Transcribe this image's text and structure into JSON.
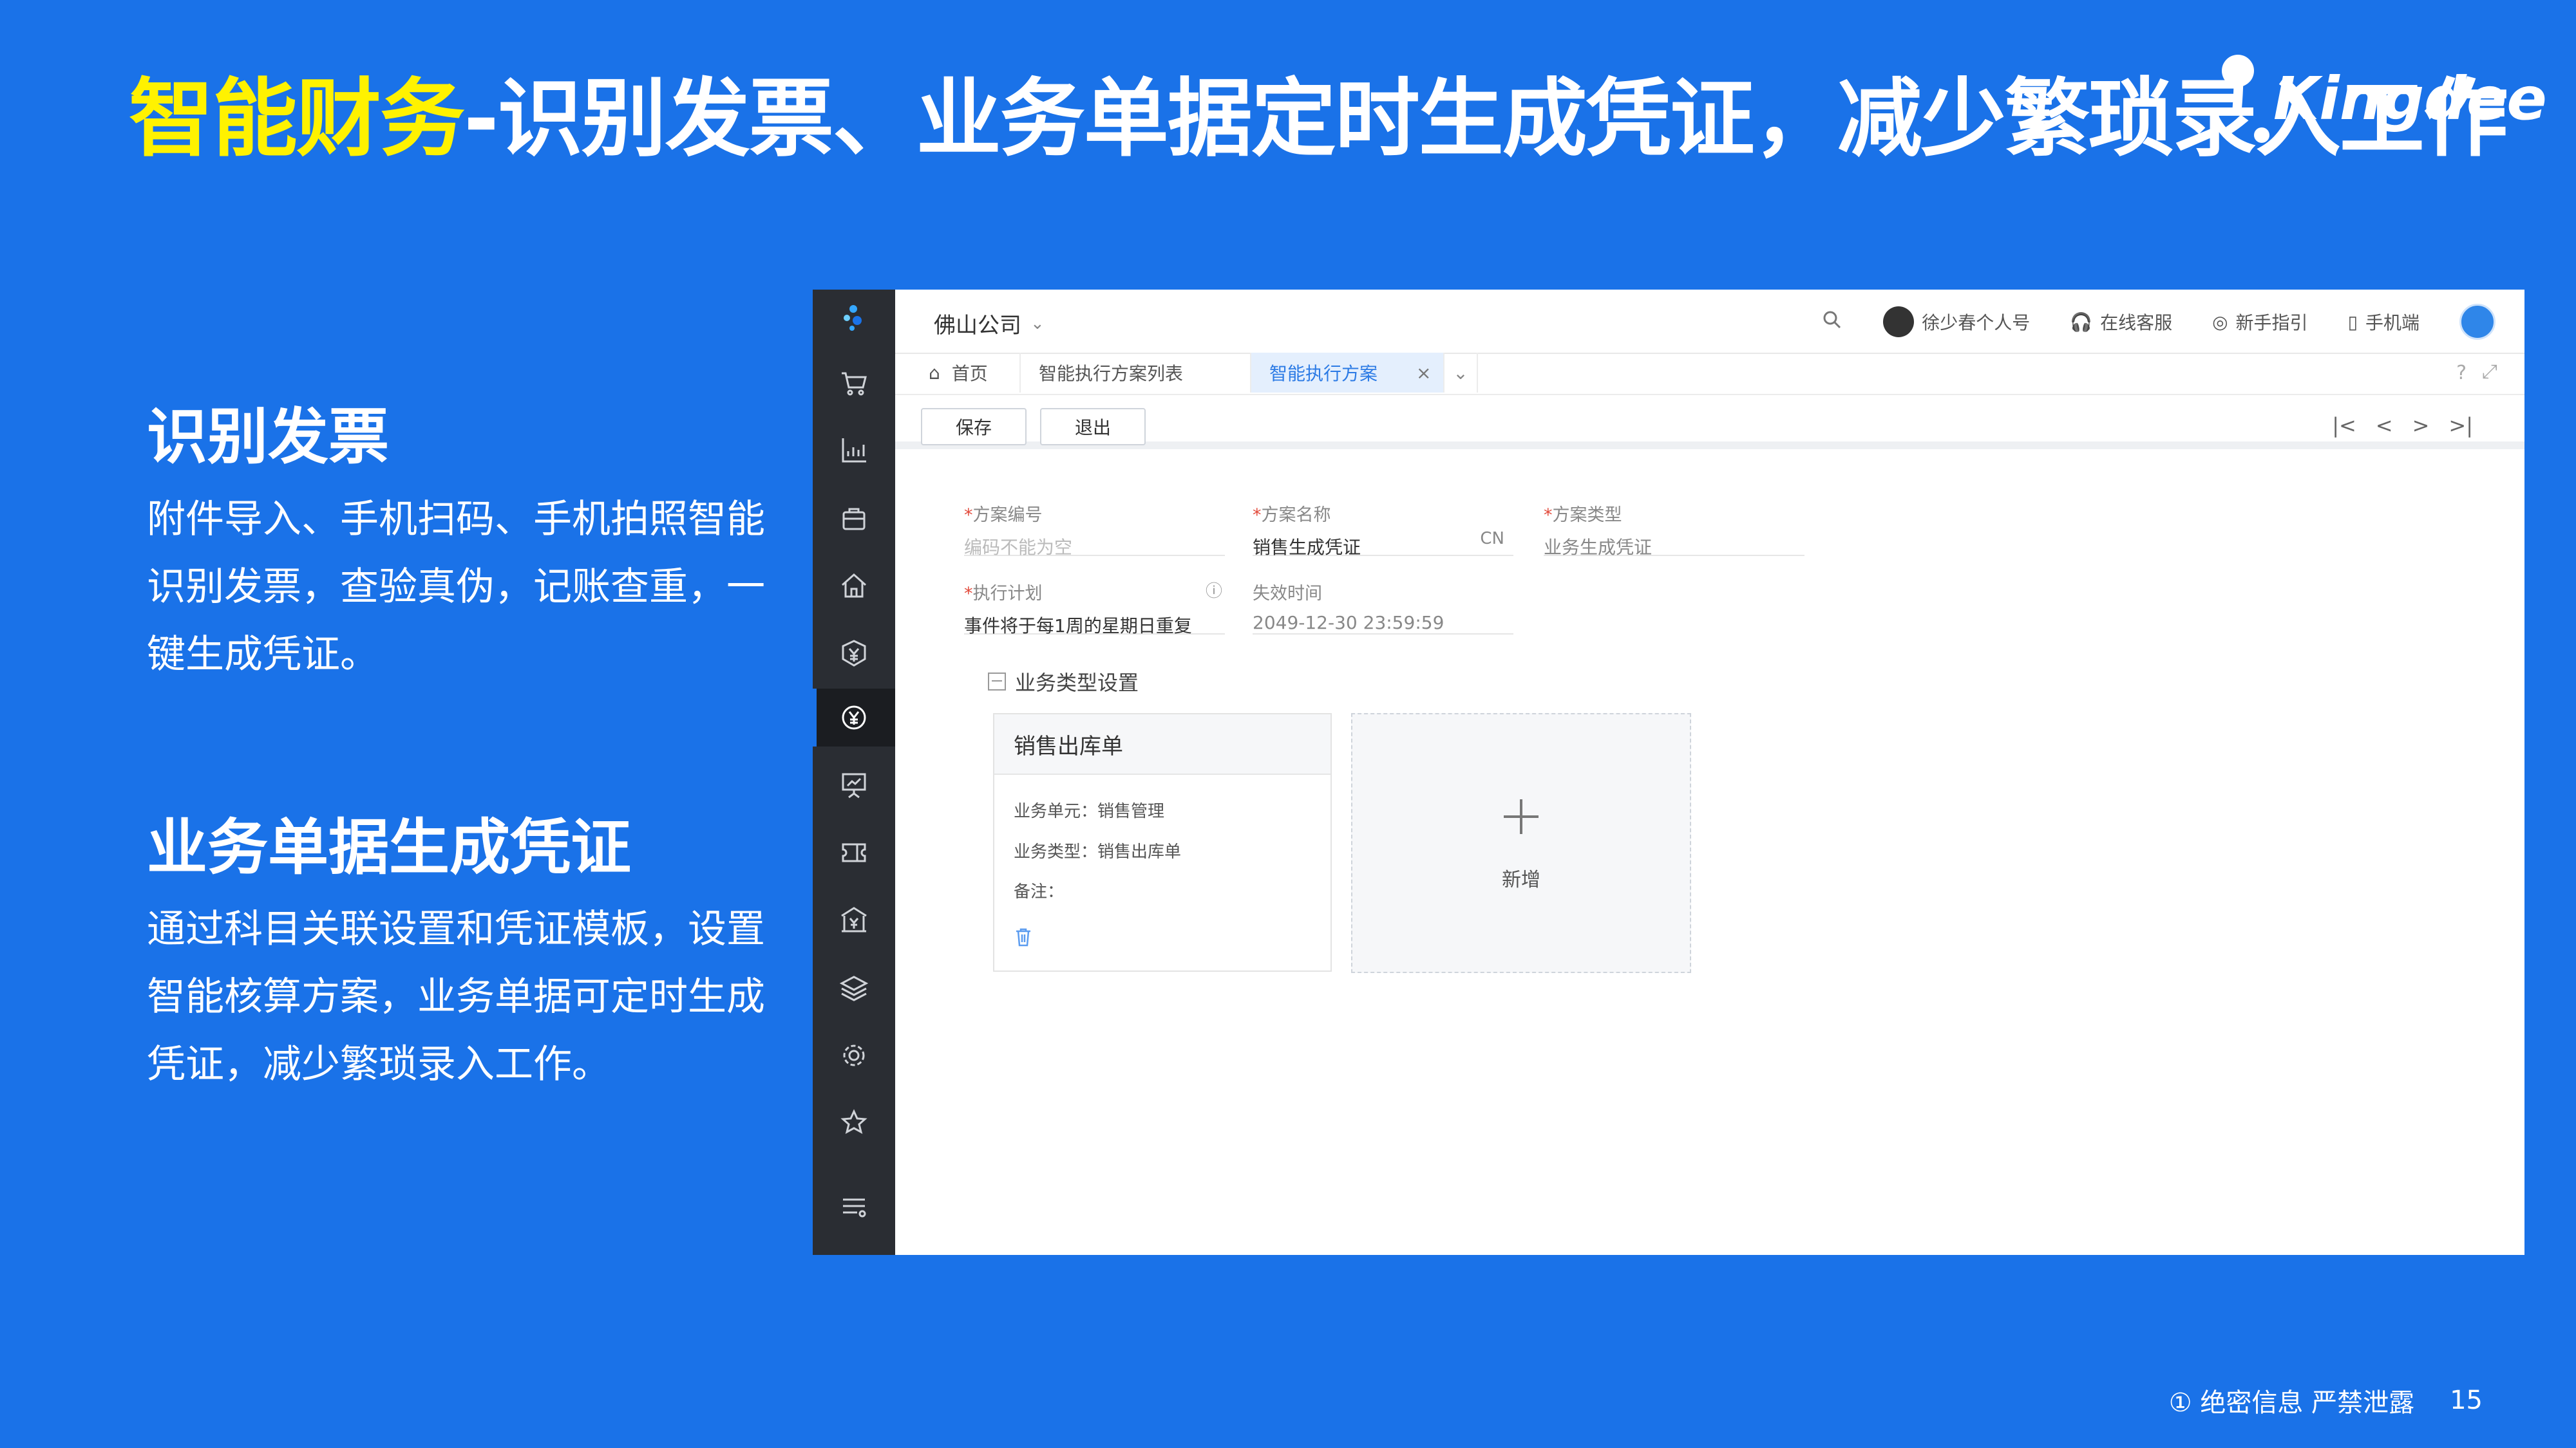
{
  "slide": {
    "title_highlight": "智能财务",
    "title_rest": "-识别发票、业务单据定时生成凭证，减少繁琐录入工作",
    "logo_text": "Kingdee",
    "section1": {
      "title": "识别发票",
      "body": "附件导入、手机扫码、手机拍照智能识别发票，查验真伪，记账查重，一键生成凭证。"
    },
    "section2": {
      "title": "业务单据生成凭证",
      "body": "通过科目关联设置和凭证模板，设置智能核算方案，业务单据可定时生成凭证，减少繁琐录入工作。"
    },
    "footer": {
      "confidential": "① 绝密信息 严禁泄露",
      "page": "15"
    }
  },
  "app": {
    "company": "佛山公司",
    "topbar": {
      "user": "徐少春个人号",
      "service": "在线客服",
      "guide": "新手指引",
      "mobile": "手机端"
    },
    "tabs": [
      "首页",
      "智能执行方案列表",
      "智能执行方案"
    ],
    "toolbar": {
      "save": "保存",
      "exit": "退出"
    },
    "form": {
      "code_label": "方案编号",
      "code_placeholder": "编码不能为空",
      "name_label": "方案名称",
      "name_value": "销售生成凭证",
      "name_lang": "CN",
      "type_label": "方案类型",
      "type_value": "业务生成凭证",
      "plan_label": "执行计划",
      "plan_value": "事件将于每1周的星期日重复",
      "expire_label": "失效时间",
      "expire_value": "2049-12-30 23:59:59"
    },
    "group_title": "业务类型设置",
    "card": {
      "title": "销售出库单",
      "unit": "业务单元：销售管理",
      "type": "业务类型：销售出库单",
      "remark": "备注："
    },
    "add_label": "新增",
    "colors": {
      "accent": "#2c7be5",
      "sidebar": "#2a2d33",
      "slide_bg": "#1a72e8",
      "title_highlight": "#fff200"
    },
    "sidebar_icons": [
      "logo-icon",
      "cart-icon",
      "chart-icon",
      "bag-icon",
      "home-icon",
      "yen-box-icon",
      "yen-circle-icon",
      "presentation-icon",
      "ticket-icon",
      "bank-icon",
      "layers-icon",
      "gear-icon",
      "star-icon",
      "menu-icon"
    ]
  }
}
